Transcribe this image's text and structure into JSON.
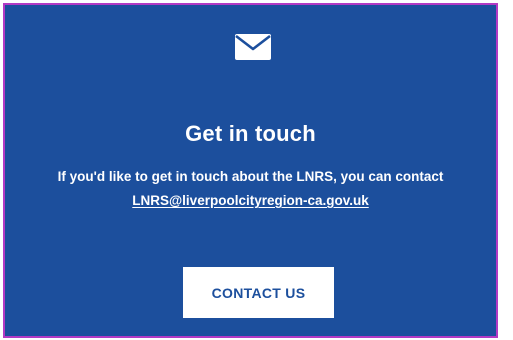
{
  "contact_card": {
    "icon": "envelope-icon",
    "title": "Get in touch",
    "intro": "If you'd like to get in touch about the LNRS, you can contact",
    "email": "LNRS@liverpoolcityregion-ca.gov.uk",
    "button_label": "CONTACT US"
  },
  "colors": {
    "background": "#1c4f9d",
    "text": "#ffffff",
    "button_bg": "#ffffff",
    "button_text": "#1c4f9d",
    "border": "#b23ac4"
  }
}
